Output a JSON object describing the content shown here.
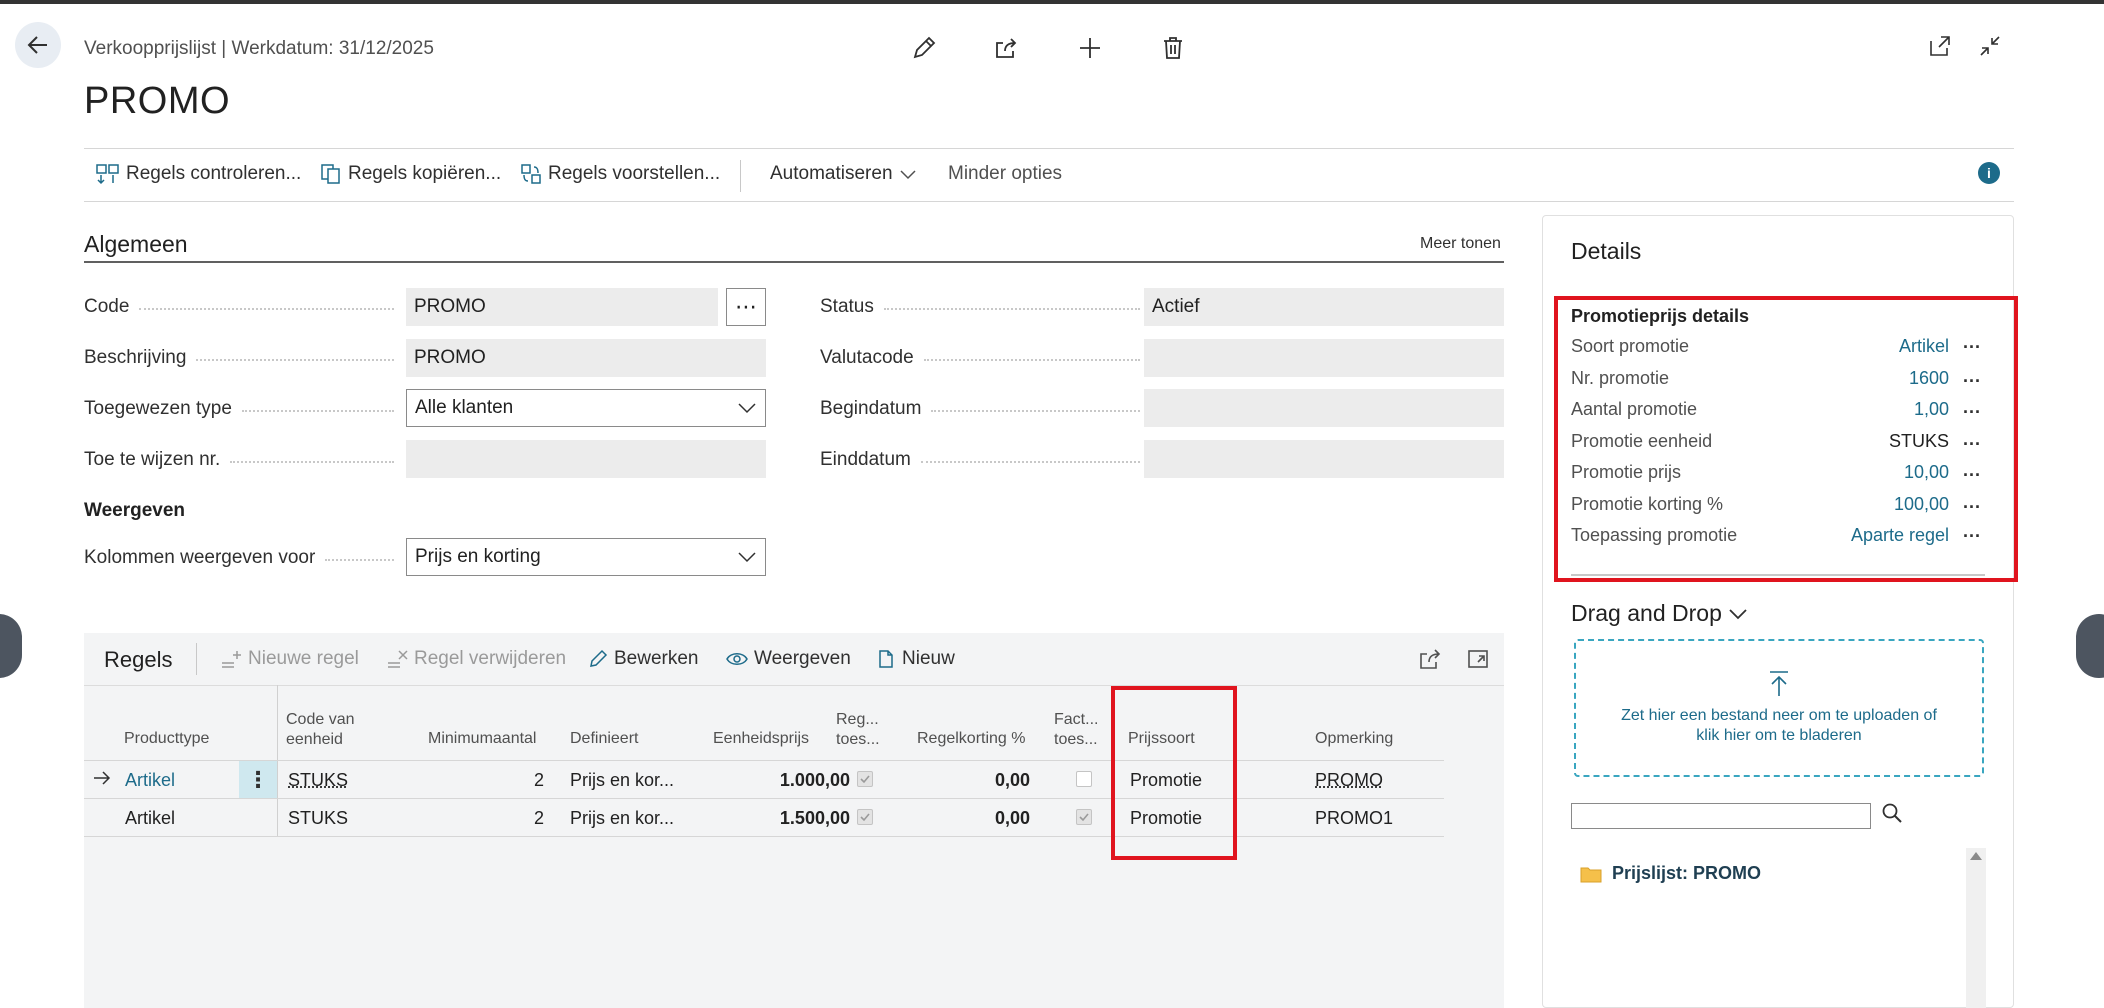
{
  "header": {
    "breadcrumb": "Verkoopprijslijst | Werkdatum: 31/12/2025",
    "title": "PROMO"
  },
  "actions": {
    "check_lines": "Regels controleren...",
    "copy_lines": "Regels kopiëren...",
    "suggest_lines": "Regels voorstellen...",
    "automate": "Automatiseren",
    "fewer_options": "Minder opties"
  },
  "general": {
    "title": "Algemeen",
    "show_more": "Meer tonen",
    "code_label": "Code",
    "code_value": "PROMO",
    "description_label": "Beschrijving",
    "description_value": "PROMO",
    "assigned_type_label": "Toegewezen type",
    "assigned_type_value": "Alle klanten",
    "assign_no_label": "Toe te wijzen nr.",
    "assign_no_value": "",
    "status_label": "Status",
    "status_value": "Actief",
    "currency_label": "Valutacode",
    "currency_value": "",
    "start_label": "Begindatum",
    "start_value": "",
    "end_label": "Einddatum",
    "end_value": "",
    "view_title": "Weergeven",
    "columns_label": "Kolommen weergeven voor",
    "columns_value": "Prijs en korting"
  },
  "lines": {
    "title": "Regels",
    "new_line": "Nieuwe regel",
    "delete_line": "Regel verwijderen",
    "edit": "Bewerken",
    "view": "Weergeven",
    "new": "Nieuw",
    "columns": {
      "product_type": "Producttype",
      "unit_code_1": "Code van",
      "unit_code_2": "eenheid",
      "min_qty": "Minimumaantal",
      "defines": "Definieert",
      "unit_price": "Eenheidsprijs",
      "line_allowed_1": "Reg...",
      "line_allowed_2": "toes...",
      "line_discount": "Regelkorting %",
      "invoice_allowed_1": "Fact...",
      "invoice_allowed_2": "toes...",
      "price_type": "Prijssoort",
      "remark": "Opmerking"
    },
    "rows": [
      {
        "product_type": "Artikel",
        "unit": "STUKS",
        "min_qty": "2",
        "defines": "Prijs en kor...",
        "unit_price": "1.000,00",
        "line_allowed": true,
        "line_discount": "0,00",
        "invoice_allowed": false,
        "price_type": "Promotie",
        "remark": "PROMO"
      },
      {
        "product_type": "Artikel",
        "unit": "STUKS",
        "min_qty": "2",
        "defines": "Prijs en kor...",
        "unit_price": "1.500,00",
        "line_allowed": true,
        "line_discount": "0,00",
        "invoice_allowed": true,
        "price_type": "Promotie",
        "remark": "PROMO1"
      }
    ]
  },
  "details": {
    "title": "Details",
    "promo_heading": "Promotieprijs details",
    "fields": [
      {
        "label": "Soort promotie",
        "value": "Artikel"
      },
      {
        "label": "Nr. promotie",
        "value": "1600"
      },
      {
        "label": "Aantal promotie",
        "value": "1,00"
      },
      {
        "label": "Promotie eenheid",
        "value": "STUKS"
      },
      {
        "label": "Promotie prijs",
        "value": "10,00"
      },
      {
        "label": "Promotie korting %",
        "value": "100,00"
      },
      {
        "label": "Toepassing promotie",
        "value": "Aparte regel"
      }
    ],
    "more_glyph": "...",
    "dragdrop_title": "Drag and Drop",
    "dropzone_text_1": "Zet hier een bestand neer om te uploaden of",
    "dropzone_text_2": "klik hier om te bladeren",
    "search_placeholder": "",
    "folder_label": "Prijslijst: PROMO"
  },
  "colors": {
    "accent": "#1d6b8a",
    "highlight": "#e0141e",
    "selected_cell": "#cfe8ef"
  }
}
